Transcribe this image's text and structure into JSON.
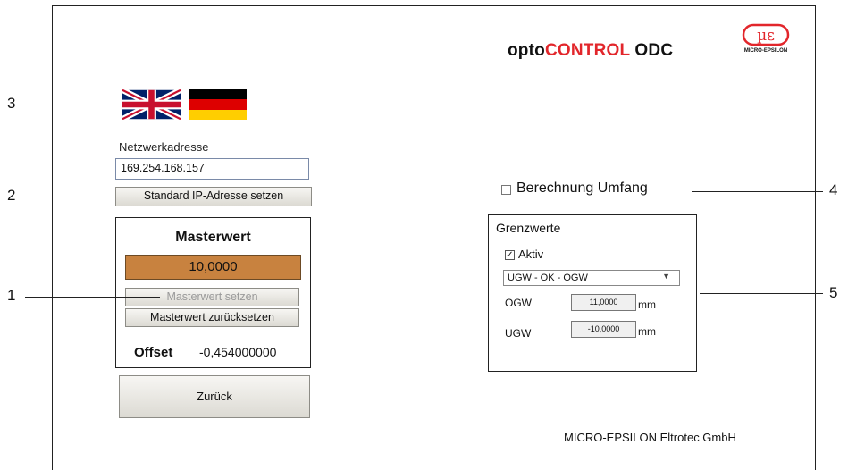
{
  "header": {
    "brand_prefix": "opto",
    "brand_main": "CONTROL",
    "brand_suffix": " ODC",
    "logo_text": "MICRO-EPSILON",
    "accent": "#e2262b"
  },
  "callouts": {
    "c1": "1",
    "c2": "2",
    "c3": "3",
    "c4": "4",
    "c5": "5"
  },
  "network": {
    "label": "Netzwerkadresse",
    "ip_value": "169.254.168.157",
    "reset_ip_button": "Standard IP-Adresse setzen"
  },
  "master": {
    "title": "Masterwert",
    "value": "10,0000",
    "set_button": "Masterwert setzen",
    "reset_button": "Masterwert zurücksetzen",
    "offset_label": "Offset",
    "offset_value": "-0,454000000",
    "value_bg": "#c8823f"
  },
  "back_button": "Zurück",
  "calc": {
    "label": "Berechnung Umfang",
    "checked": false
  },
  "limits": {
    "title": "Grenzwerte",
    "active_label": "Aktiv",
    "active_checked": true,
    "mode_selected": "UGW - OK - OGW",
    "ogw_label": "OGW",
    "ogw_value": "11,0000",
    "ugw_label": "UGW",
    "ugw_value": "-10,0000",
    "unit": "mm"
  },
  "footer": {
    "company": "MICRO-EPSILON Eltrotec GmbH"
  }
}
